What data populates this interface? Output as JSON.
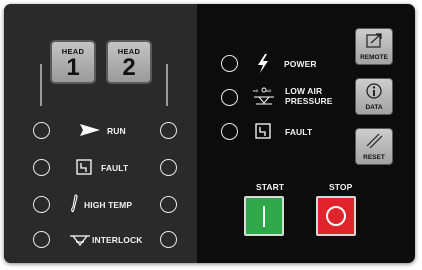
{
  "head_buttons": [
    {
      "label": "HEAD",
      "number": "1"
    },
    {
      "label": "HEAD",
      "number": "2"
    }
  ],
  "left_indicators": {
    "run": "RUN",
    "fault": "FAULT",
    "high_temp": "HIGH TEMP",
    "interlock": "INTERLOCK"
  },
  "right_indicators": {
    "power": "POWER",
    "low_air_line1": "LOW AIR",
    "low_air_line2": "PRESSURE",
    "fault": "FAULT"
  },
  "side_buttons": {
    "remote": "REMOTE",
    "data": "DATA",
    "reset": "RESET"
  },
  "start_label": "START",
  "stop_label": "STOP",
  "colors": {
    "start": "#2fa84a",
    "stop": "#e0242c",
    "panel_dark": "#0c0c0c",
    "panel_left": "#2a2a2a"
  }
}
